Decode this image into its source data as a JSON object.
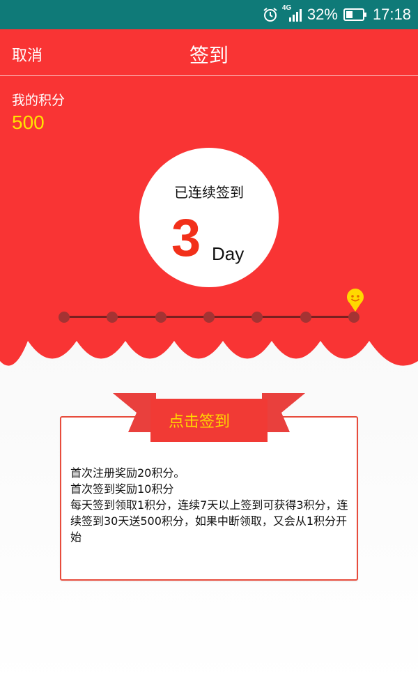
{
  "status_bar": {
    "network": "4G",
    "battery": "32%",
    "time": "17:18"
  },
  "nav": {
    "cancel_label": "取消",
    "title": "签到"
  },
  "points": {
    "label": "我的积分",
    "value": "500"
  },
  "streak": {
    "label": "已连续签到",
    "count": "3",
    "unit": "Day"
  },
  "progress": {
    "total_days": 7,
    "current_day": 7
  },
  "signin": {
    "button_label": "点击签到",
    "rules": [
      "首次注册奖励20积分。",
      "首次签到奖励10积分",
      "每天签到领取1积分，连续7天以上签到可获得3积分，连续签到30天送500积分，如果中断领取，又会从1积分开始"
    ]
  },
  "colors": {
    "status_bar": "#0f7a78",
    "brand_red": "#f93434",
    "points_yellow": "#ffe400",
    "streak_red": "#f2301a"
  }
}
